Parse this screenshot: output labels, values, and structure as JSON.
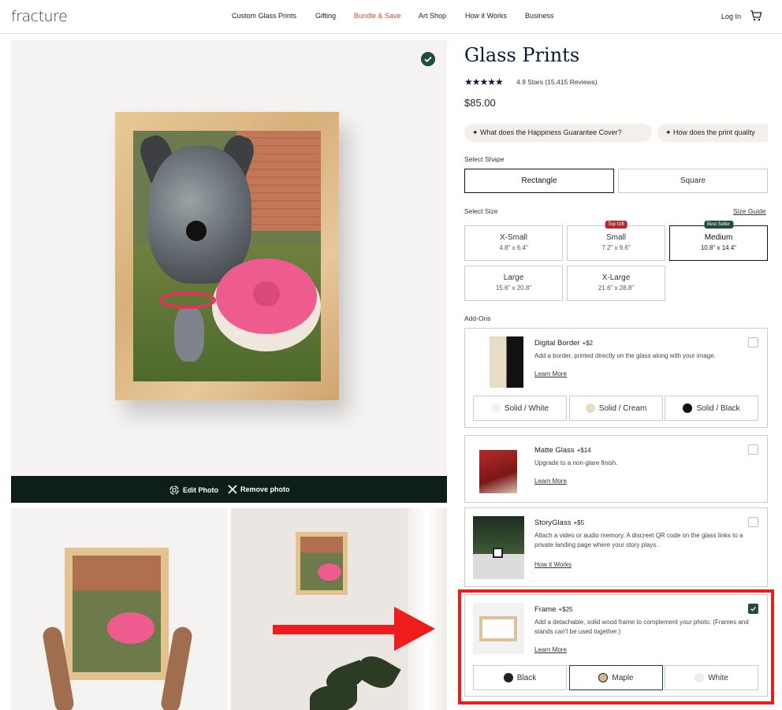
{
  "header": {
    "logo": "fracture",
    "nav": [
      "Custom Glass Prints",
      "Gifting",
      "Bundle & Save",
      "Art Shop",
      "How it Works",
      "Business"
    ],
    "login": "Log In"
  },
  "gallery": {
    "edit_photo": "Edit Photo",
    "remove_photo": "Remove photo"
  },
  "product": {
    "title": "Glass Prints",
    "stars": "★★★★★",
    "rating": "4.9 Stars (15,415 Reviews)",
    "price": "$85.00",
    "faqs": [
      "What does the Happiness Guarantee Cover?",
      "How does the print quality"
    ]
  },
  "shape": {
    "label": "Select Shape",
    "options": [
      "Rectangle",
      "Square"
    ],
    "selected": "Rectangle"
  },
  "size": {
    "label": "Select Size",
    "guide": "Size Guide",
    "options": [
      {
        "name": "X-Small",
        "dims": "4.8\" x 6.4\"",
        "badge": ""
      },
      {
        "name": "Small",
        "dims": "7.2\" x 9.6\"",
        "badge": "Top Gift"
      },
      {
        "name": "Medium",
        "dims": "10.8\" x 14.4\"",
        "badge": "Best Seller"
      },
      {
        "name": "Large",
        "dims": "15.6\" x 20.8\"",
        "badge": ""
      },
      {
        "name": "X-Large",
        "dims": "21.6\" x 28.8\"",
        "badge": ""
      }
    ],
    "selected": "Medium"
  },
  "addons": {
    "label": "Add-Ons",
    "items": [
      {
        "name": "Digital Border",
        "price": "+$2",
        "desc": "Add a border, printed directly on the glass along with your image.",
        "link": "Learn More",
        "checked": false,
        "options": [
          {
            "label": "Solid / White",
            "color": "#f2f2f2"
          },
          {
            "label": "Solid / Cream",
            "color": "#e9dcc5"
          },
          {
            "label": "Solid / Black",
            "color": "#111111"
          }
        ]
      },
      {
        "name": "Matte Glass",
        "price": "+$14",
        "desc": "Upgrade to a non-glare finish.",
        "link": "Learn More",
        "checked": false
      },
      {
        "name": "StoryGlass",
        "price": "+$5",
        "desc": "Attach a video or audio memory.  A discreet QR code on the glass links to a private landing page where your story plays.",
        "link": "How it Works",
        "checked": false
      },
      {
        "name": "Frame",
        "price": "+$25",
        "desc": "Add a detachable, solid wood frame to complement your photo. (Frames and stands can't be used together.)",
        "link": "Learn More",
        "checked": true,
        "options": [
          {
            "label": "Black",
            "color": "#1c2227"
          },
          {
            "label": "Maple",
            "color": "#d8b98e"
          },
          {
            "label": "White",
            "color": "#ecebe8"
          }
        ],
        "selected_option": "Maple"
      }
    ]
  },
  "colors": {
    "accent_green": "#234d3a",
    "nav_highlight": "#d64934",
    "annotation_red": "#ee1c1c",
    "selected_blue": "#0e3a62"
  }
}
